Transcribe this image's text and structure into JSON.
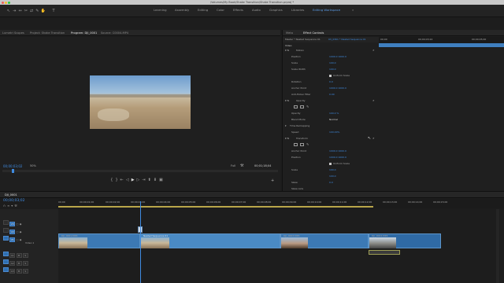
{
  "window": {
    "title": "/Volumes/My Book/Shake Transition/Shake Transition.prproj *",
    "traffic_lights": [
      "#ee5f57",
      "#f6bd2f",
      "#29c841"
    ]
  },
  "workspaces": {
    "items": [
      "Learning",
      "Assembly",
      "Editing",
      "Color",
      "Effects",
      "Audio",
      "Graphics",
      "Libraries",
      "Editing Workspace"
    ],
    "active_index": 8
  },
  "source_panel": {
    "tabs": [
      "Lumetri Scopes",
      "Project: Shake Transition",
      "Program: DJI_0001",
      "Source: C0004.MP4"
    ],
    "active_index": 2,
    "timecode": "00;00;03;02",
    "zoom": "50%",
    "quality": "Full",
    "duration": "00;01;18;04"
  },
  "effect_controls": {
    "tabs": [
      "Meta",
      "Effect Controls"
    ],
    "active_index": 1,
    "source_label": "Master * Nested Sequence 01",
    "clip_label": "03_0301 * Nested Sequence 01",
    "ruler_labels": [
      "00;00",
      "00;00;03;24",
      "00;00;05;00"
    ],
    "section_video": "Video",
    "rows": [
      {
        "label": "Motion",
        "value": ""
      },
      {
        "label": "Position",
        "value": "1000.0   1000.0"
      },
      {
        "label": "Scale",
        "value": "100.0"
      },
      {
        "label": "Scale Width",
        "value": "100.0"
      },
      {
        "label": "",
        "value": "Uniform Scale"
      },
      {
        "label": "Rotation",
        "value": "0.0"
      },
      {
        "label": "Anchor Point",
        "value": "1000.0   1000.0"
      },
      {
        "label": "Anti-flicker Filter",
        "value": "0.00"
      },
      {
        "label": "Opacity",
        "value": ""
      },
      {
        "label": "Opacity",
        "value": "100.0 %"
      },
      {
        "label": "Blend Mode",
        "value": "Normal"
      },
      {
        "label": "Time Remapping",
        "value": ""
      },
      {
        "label": "Speed",
        "value": "100.00%"
      },
      {
        "label": "Transform",
        "value": ""
      },
      {
        "label": "Anchor Point",
        "value": "1000.0   1000.0"
      },
      {
        "label": "Position",
        "value": "1000.0   1000.0"
      },
      {
        "label": "",
        "value": "Uniform Scale"
      },
      {
        "label": "Scale",
        "value": "100.0"
      },
      {
        "label": "",
        "value": "100.0"
      },
      {
        "label": "Skew",
        "value": "0.0"
      },
      {
        "label": "Skew Axis",
        "value": "0.0"
      },
      {
        "label": "Rotation",
        "value": "0.0"
      }
    ]
  },
  "timeline": {
    "tab_label": "DJI_0001",
    "timecode": "00;00;03;02",
    "ruler": [
      "00;00",
      "00;00;01;00",
      "00;00;02;00",
      "00;00;03;00",
      "00;00;04;00",
      "00;00;05;00",
      "00;00;06;00",
      "00;00;07;00",
      "00;00;08;00",
      "00;00;09;00",
      "00;00;10;00",
      "00;00;11;00",
      "00;00;12;00",
      "00;00;13;00",
      "00;00;14;00",
      "00;00;15;00"
    ],
    "tracks": [
      {
        "name": "V3",
        "type": "video"
      },
      {
        "name": "V2",
        "type": "video"
      },
      {
        "name": "V1",
        "type": "video",
        "label": "Video 1"
      },
      {
        "name": "A1",
        "type": "audio"
      },
      {
        "name": "A2",
        "type": "audio"
      },
      {
        "name": "A3",
        "type": "audio"
      }
    ],
    "clips": [
      {
        "label": "DJI_0001.MP4"
      },
      {
        "label": "Nested Sequence 01"
      },
      {
        "label": "DJI_0003.MP4"
      },
      {
        "label": "DJI_0004.MP4"
      }
    ]
  }
}
